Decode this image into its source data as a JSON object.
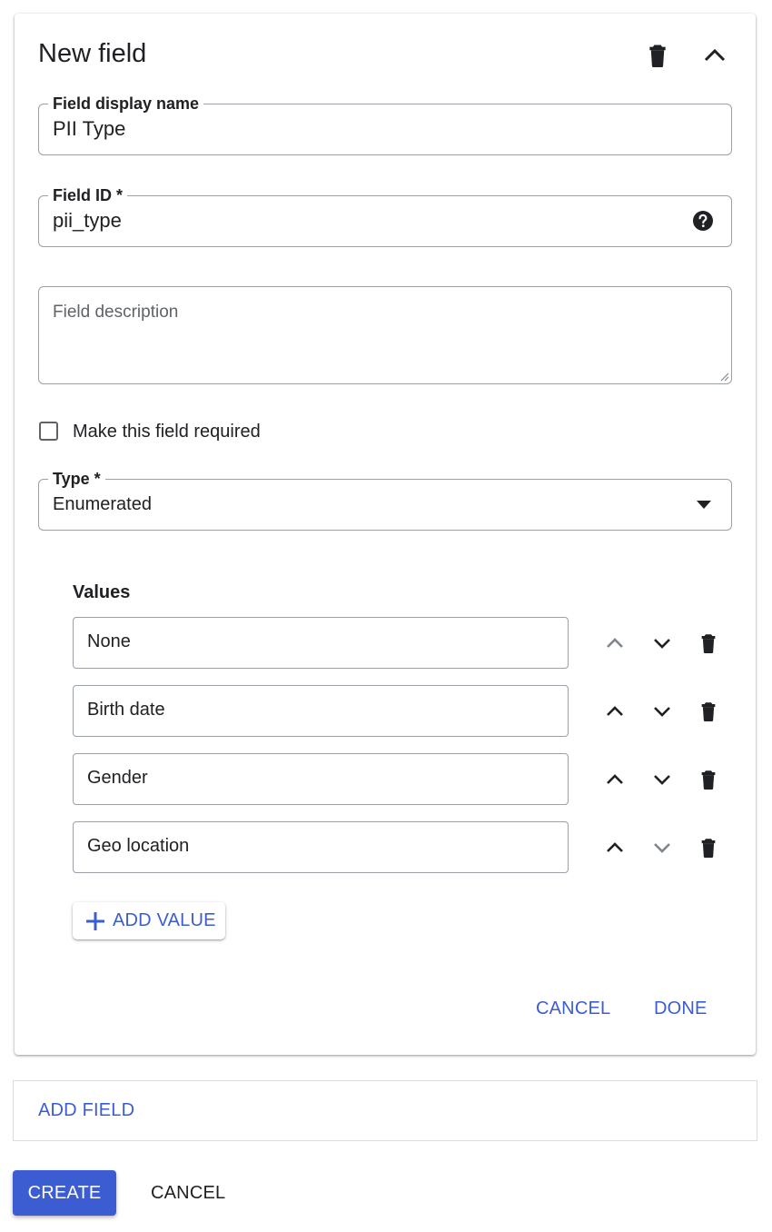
{
  "card": {
    "title": "New field",
    "delete_icon": "trash-icon",
    "collapse_icon": "chevron-up-icon"
  },
  "fields": {
    "display_name": {
      "label": "Field display name",
      "value": "PII Type"
    },
    "field_id": {
      "label": "Field ID *",
      "value": "pii_type",
      "help_icon": "help-circle-icon"
    },
    "description": {
      "placeholder": "Field description",
      "value": ""
    },
    "required": {
      "label": "Make this field required",
      "checked": false
    },
    "type": {
      "label": "Type *",
      "value": "Enumerated",
      "dropdown_icon": "caret-down-icon"
    }
  },
  "values": {
    "label": "Values",
    "items": [
      {
        "value": "None",
        "up_enabled": false,
        "down_enabled": true
      },
      {
        "value": "Birth date",
        "up_enabled": true,
        "down_enabled": true
      },
      {
        "value": "Gender",
        "up_enabled": true,
        "down_enabled": true
      },
      {
        "value": "Geo location",
        "up_enabled": true,
        "down_enabled": false
      }
    ],
    "add_label": "ADD VALUE"
  },
  "card_actions": {
    "cancel_label": "CANCEL",
    "done_label": "DONE"
  },
  "add_field_label": "ADD FIELD",
  "footer": {
    "create_label": "CREATE",
    "cancel_label": "CANCEL"
  },
  "colors": {
    "accent": "#3c5cd1",
    "text": "#202124",
    "disabled_icon": "#80868b",
    "border": "#9aa0a6"
  }
}
